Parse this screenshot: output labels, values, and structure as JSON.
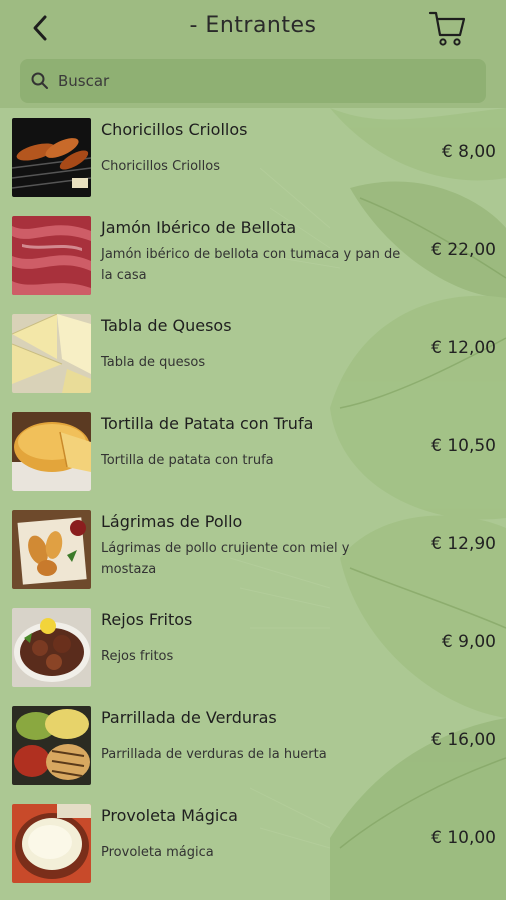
{
  "header": {
    "title": "- Entrantes",
    "back_icon": "back-arrow-icon",
    "cart_icon": "cart-icon"
  },
  "search": {
    "placeholder": "Buscar",
    "value": ""
  },
  "colors": {
    "background": "#a8c38c",
    "search_bg": "#8fb073",
    "leaf": "#6f9a52"
  },
  "items": [
    {
      "name": "Choricillos Criollos",
      "description": "Choricillos Criollos",
      "price": "€ 8,00"
    },
    {
      "name": "Jamón Ibérico de Bellota",
      "description": "Jamón ibérico de bellota con tumaca y pan de la casa",
      "price": "€ 22,00"
    },
    {
      "name": "Tabla de Quesos",
      "description": "Tabla de quesos",
      "price": "€ 12,00"
    },
    {
      "name": "Tortilla de Patata con Trufa",
      "description": "Tortilla de patata con trufa",
      "price": "€ 10,50"
    },
    {
      "name": "Lágrimas de Pollo",
      "description": "Lágrimas de pollo crujiente con miel y mostaza",
      "price": "€ 12,90"
    },
    {
      "name": "Rejos Fritos",
      "description": "Rejos fritos",
      "price": "€ 9,00"
    },
    {
      "name": "Parrillada de Verduras",
      "description": "Parrillada de verduras de la huerta",
      "price": "€ 16,00"
    },
    {
      "name": "Provoleta Mágica",
      "description": "Provoleta mágica",
      "price": "€ 10,00"
    }
  ]
}
